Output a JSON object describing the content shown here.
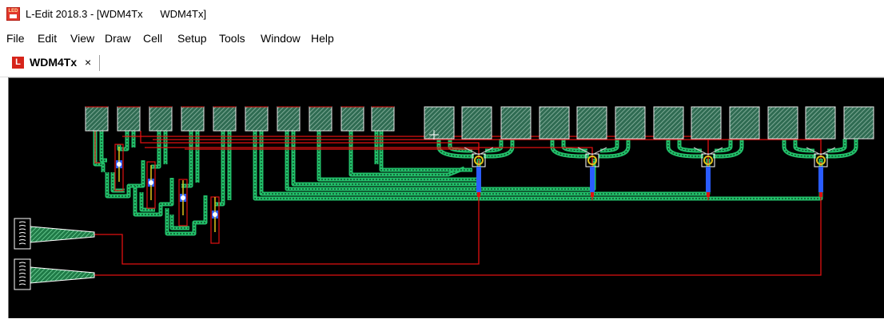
{
  "window": {
    "title": "L-Edit 2018.3 - [WDM4Tx      WDM4Tx]",
    "icon": "ledit-app-icon",
    "icon_text": "LED"
  },
  "menu": {
    "items": [
      "File",
      "Edit",
      "View",
      "Draw",
      "Cell",
      "Setup",
      "Tools",
      "Window",
      "Help"
    ]
  },
  "tab": {
    "label": "WDM4Tx",
    "close_label": "×",
    "icon_text": "L"
  },
  "layout_view": {
    "background": "#000000",
    "colors": {
      "waveguide": "#22c06a",
      "metal": "#e01010",
      "pad_fill": "#2f6b52",
      "pad_border": "#e6e6e6",
      "pad_hatch": "#8fb7a5",
      "via": "#2a5cff",
      "component": "#e2c21c",
      "coupler": "#ffffff"
    },
    "small_pad_count": 10,
    "large_pad_count": 12,
    "ring_count": 4,
    "modulator_count": 4,
    "fiber_coupler_count": 2
  }
}
